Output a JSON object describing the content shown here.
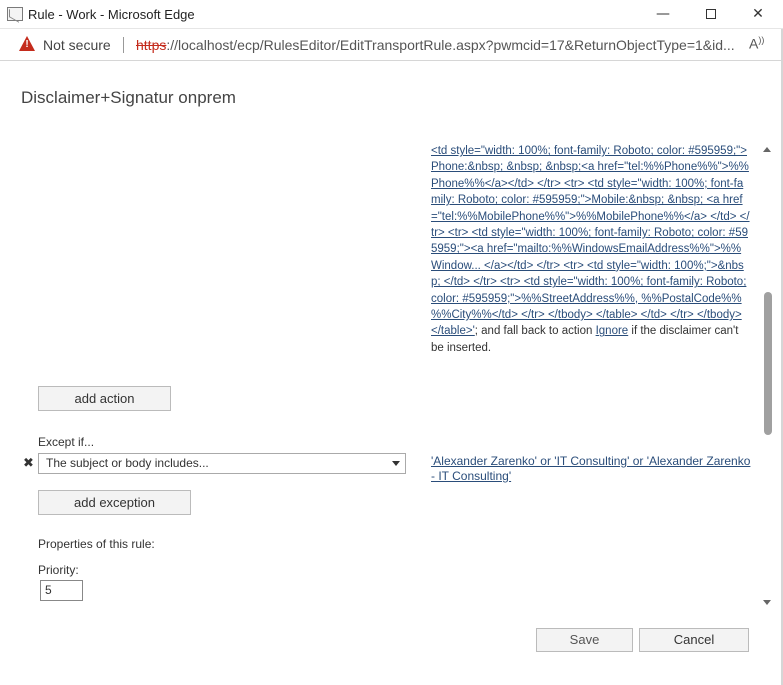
{
  "window": {
    "title": "Rule - Work - Microsoft Edge",
    "minimize": "—",
    "close": "✕"
  },
  "address_bar": {
    "security_label": "Not secure",
    "url_scheme": "https",
    "url_rest": "://localhost/ecp/RulesEditor/EditTransportRule.aspx?pwmcid=17&ReturnObjectType=1&id...",
    "read_aloud": "A))"
  },
  "page": {
    "rule_title": "Disclaimer+Signatur onprem"
  },
  "action_summary": {
    "disclaimer_html": "<td style=\"width: 100%; font-family: Roboto; color: #595959;\">Phone:&nbsp; &nbsp; &nbsp;<a href=\"tel:%%Phone%%\">%%Phone%%</a></td> </tr> <tr> <td style=\"width: 100%; font-family: Roboto; color: #595959;\">Mobile:&nbsp; &nbsp; <a href=\"tel:%%MobilePhone%%\">%%MobilePhone%%</a> </td> </tr> <tr> <td style=\"width: 100%; font-family: Roboto; color: #595959;\"><a href=\"mailto:%%WindowsEmailAddress%%\">%%Window... </a></td> </tr> <tr> <td style=\"width: 100%;\">&nbsp; </td> </tr> <tr> <td style=\"width: 100%; font-family: Roboto; color: #595959;\">%%StreetAddress%%, %%PostalCode%% %%City%%</td> </tr> </tbody> </table> </td> </tr> </tbody> </table>'",
    "fallback_text": "; and fall back to action ",
    "fallback_link": "Ignore",
    "fallback_suffix": " if the disclaimer can't be inserted."
  },
  "buttons": {
    "add_action": "add action",
    "add_exception": "add exception",
    "save": "Save",
    "cancel": "Cancel"
  },
  "exception": {
    "label": "Except if...",
    "remove": "✖",
    "condition": "The subject or body includes...",
    "summary": "'Alexander Zarenko' or 'IT Consulting' or 'Alexander Zarenko - IT Consulting'"
  },
  "properties": {
    "label": "Properties of this rule:",
    "priority_label": "Priority:",
    "priority_value": "5"
  }
}
